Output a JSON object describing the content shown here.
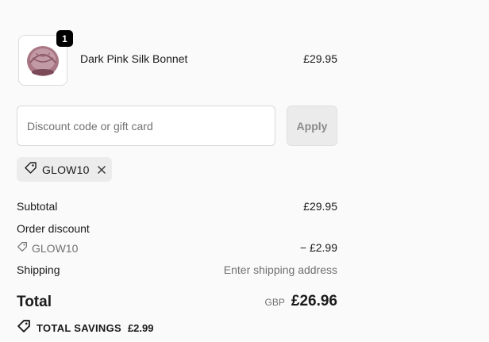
{
  "line_item": {
    "quantity": "1",
    "name": "Dark Pink Silk Bonnet",
    "price": "£29.95",
    "image_icon": "bonnet-product-image"
  },
  "discount": {
    "placeholder": "Discount code or gift card",
    "value": "",
    "apply_label": "Apply",
    "applied_code": "GLOW10"
  },
  "totals": {
    "subtotal_label": "Subtotal",
    "subtotal_value": "£29.95",
    "order_discount_label": "Order discount",
    "discount_code": "GLOW10",
    "discount_value": "− £2.99",
    "shipping_label": "Shipping",
    "shipping_value": "Enter shipping address",
    "total_label": "Total",
    "currency": "GBP",
    "total_value": "£26.96",
    "savings_label": "TOTAL SAVINGS",
    "savings_value": "£2.99"
  },
  "colors": {
    "background": "#fafafa",
    "badge": "#000000",
    "chip": "#ececec",
    "muted_text": "#707070",
    "product": "#b07a86"
  }
}
